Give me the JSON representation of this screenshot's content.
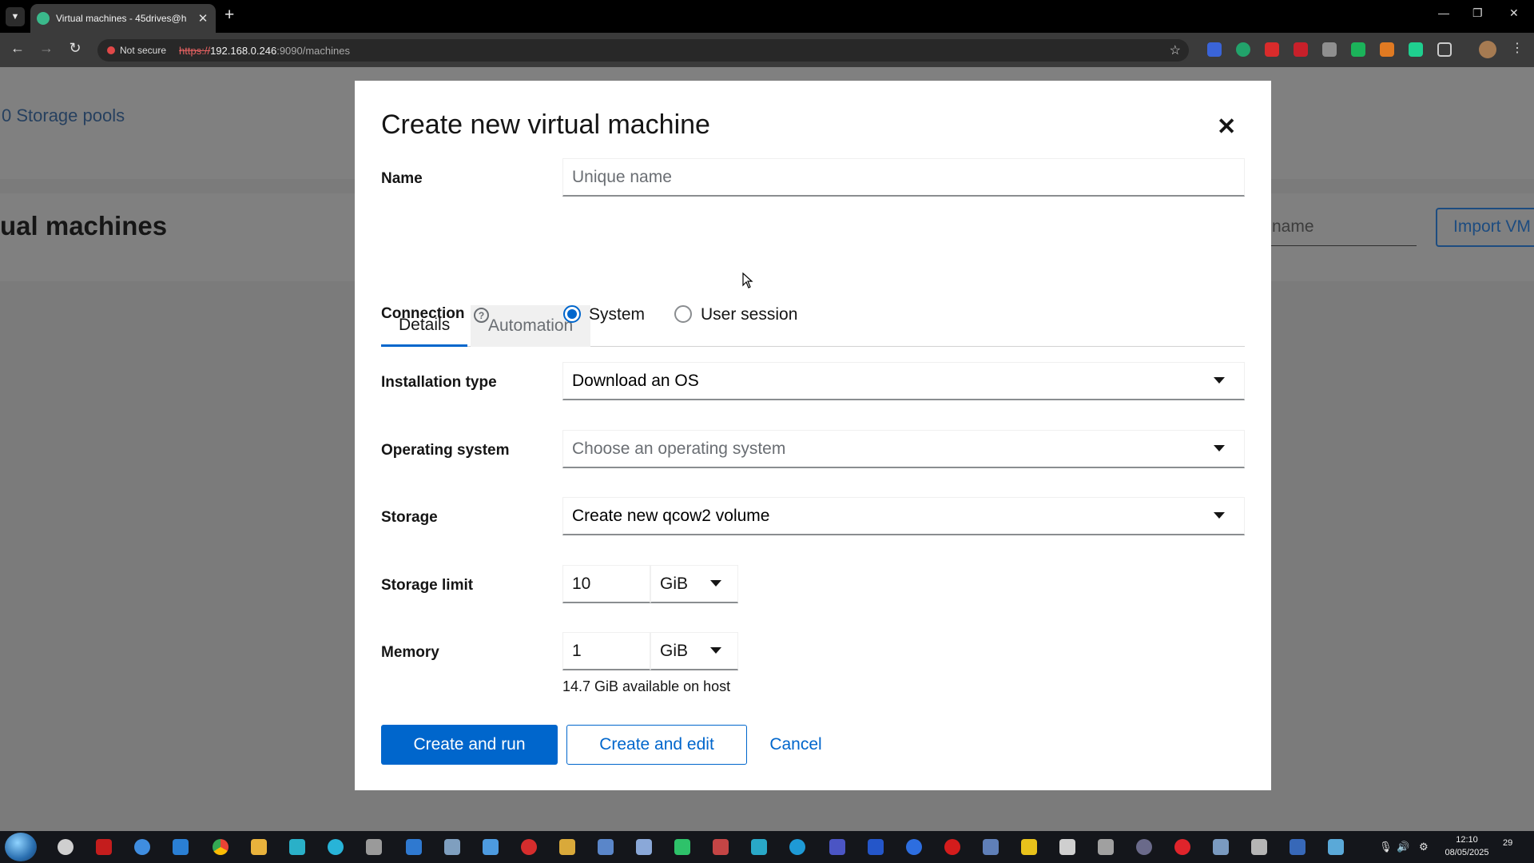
{
  "browser": {
    "tab_title": "Virtual machines - 45drives@h",
    "not_secure": "Not secure",
    "url_scheme": "https://",
    "url_host": "192.168.0.246",
    "url_path": ":9090/machines"
  },
  "background": {
    "storage_pools_link": "0 Storage pools",
    "heading": "ual machines",
    "filter_placeholder": "name",
    "import_button": "Import VM"
  },
  "modal": {
    "title": "Create new virtual machine",
    "name_label": "Name",
    "name_placeholder": "Unique name",
    "tabs": [
      "Details",
      "Automation"
    ],
    "connection_label": "Connection",
    "connection_options": [
      "System",
      "User session"
    ],
    "connection_selected": "System",
    "install_type_label": "Installation type",
    "install_type_value": "Download an OS",
    "os_label": "Operating system",
    "os_placeholder": "Choose an operating system",
    "storage_label": "Storage",
    "storage_value": "Create new qcow2 volume",
    "storage_limit_label": "Storage limit",
    "storage_limit_value": "10",
    "storage_limit_unit": "GiB",
    "memory_label": "Memory",
    "memory_value": "1",
    "memory_unit": "GiB",
    "memory_helper": "14.7 GiB available on host",
    "buttons": {
      "create_run": "Create and run",
      "create_edit": "Create and edit",
      "cancel": "Cancel"
    }
  },
  "taskbar": {
    "time": "12:10",
    "date": "08/05/2025",
    "notifications": "29"
  },
  "colors": {
    "primary": "#0066cc",
    "overlay": "#7b7b7b"
  }
}
